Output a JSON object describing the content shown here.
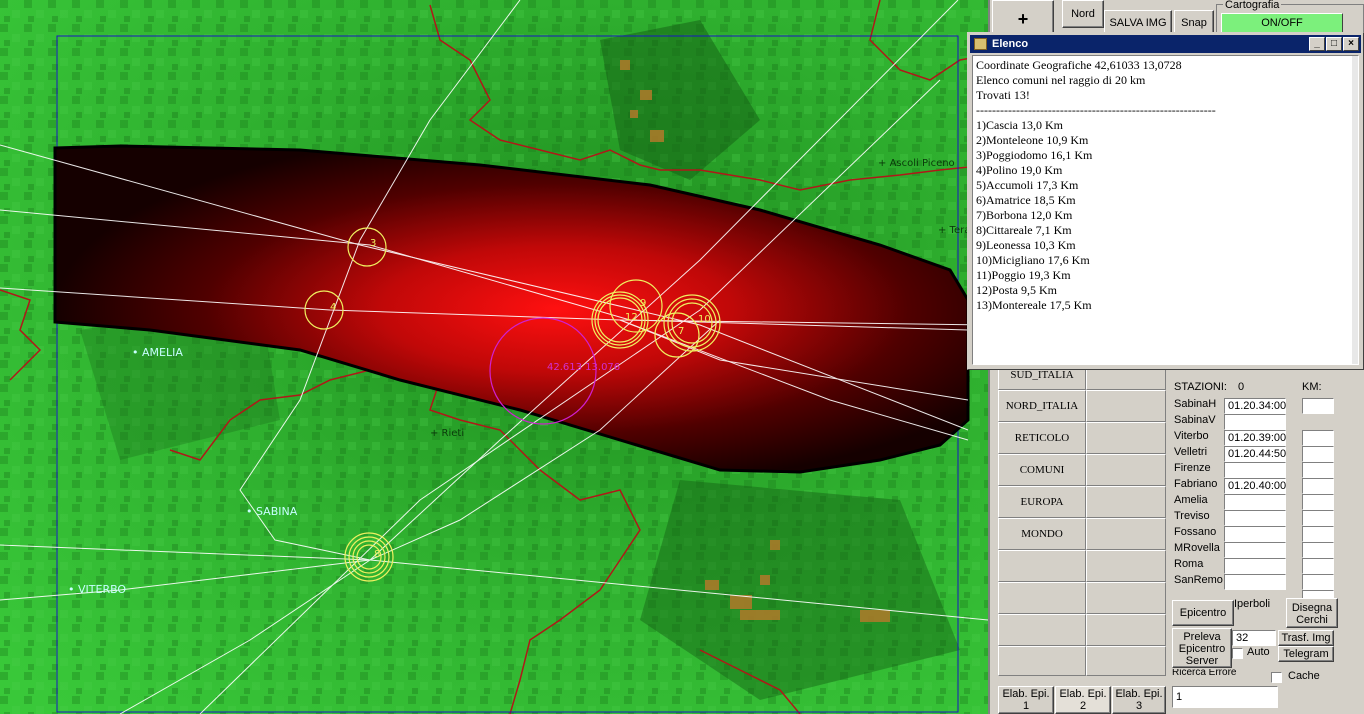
{
  "toolbar": {
    "zoom_in": "+",
    "nord": "Nord",
    "salva_img": "SALVA IMG",
    "snap": "Snap",
    "cartografia_label": "Cartografia",
    "onoff": "ON/OFF"
  },
  "map": {
    "cities": [
      {
        "name": "Ascoli Piceno",
        "style": "dark"
      },
      {
        "name": "+ Tera",
        "style": "dark"
      },
      {
        "name": "AMELIA",
        "style": "cyan"
      },
      {
        "name": "+ Rieti",
        "style": "dark"
      },
      {
        "name": "SABINA",
        "style": "cyan"
      },
      {
        "name": "VITERBO",
        "style": "cyan"
      }
    ],
    "circle_labels": [
      "3",
      "4",
      "12",
      "9",
      "10",
      "7",
      "8"
    ],
    "epicenter_label": "42.613 13.076"
  },
  "elenco": {
    "title": "Elenco",
    "lines": [
      "Coordinate Geografiche 42,61033 13,0728",
      "Elenco comuni nel raggio di 20 km",
      "Trovati 13!",
      "------------------------------------------------------------",
      "",
      "1)Cascia 13,0 Km",
      "2)Monteleone 10,9 Km",
      "3)Poggiodomo 16,1 Km",
      "4)Polino 19,0 Km",
      "5)Accumoli 17,3 Km",
      "6)Amatrice 18,5 Km",
      "7)Borbona 12,0 Km",
      "8)Cittareale 7,1 Km",
      "9)Leonessa 10,3 Km",
      "10)Micigliano 17,6 Km",
      "11)Poggio 19,3 Km",
      "12)Posta 9,5 Km",
      "13)Montereale 17,5 Km"
    ]
  },
  "region_buttons": [
    "SUD_ITALIA",
    "NORD_ITALIA",
    "RETICOLO",
    "COMUNI",
    "EUROPA",
    "MONDO"
  ],
  "stazioni": {
    "header": "STAZIONI:",
    "count": "0",
    "km_label": "KM:",
    "rows": [
      {
        "name": "SabinaH",
        "time": "01.20.34:00"
      },
      {
        "name": "SabinaV",
        "time": ""
      },
      {
        "name": "Viterbo",
        "time": "01.20.39:00"
      },
      {
        "name": "Velletri",
        "time": "01.20.44:50"
      },
      {
        "name": "Firenze",
        "time": ""
      },
      {
        "name": "Fabriano",
        "time": "01.20.40:00"
      },
      {
        "name": "Amelia",
        "time": ""
      },
      {
        "name": "Treviso",
        "time": ""
      },
      {
        "name": "Fossano",
        "time": ""
      },
      {
        "name": "MRovella",
        "time": ""
      },
      {
        "name": "Roma",
        "time": ""
      },
      {
        "name": "SanRemo",
        "time": ""
      }
    ]
  },
  "controls": {
    "epicentro": "Epicentro",
    "iperboli": "Iperboli",
    "disegna_cerchi": "Disegna Cerchi",
    "preleva": "Preleva Epicentro Server",
    "preleva_value": "32",
    "trasf_img": "Trasf. Img",
    "telegram": "Telegram",
    "auto": "Auto",
    "cache": "Cache",
    "ricerca_label": "Ricerca Errore",
    "bottom_value": "1"
  },
  "tabs": [
    "Elab. Epi. 1",
    "Elab. Epi. 2",
    "Elab. Epi. 3"
  ]
}
